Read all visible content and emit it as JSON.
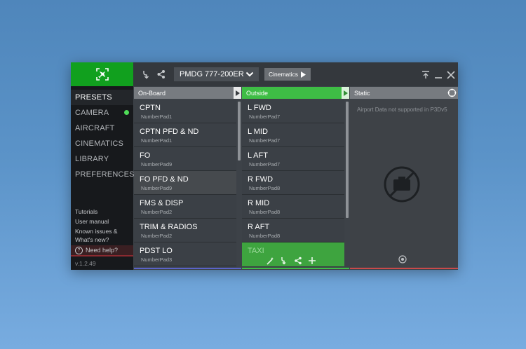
{
  "sidebar": {
    "items": [
      {
        "label": "PRESETS",
        "active": true
      },
      {
        "label": "CAMERA",
        "active": false,
        "status_dot": true
      },
      {
        "label": "AIRCRAFT",
        "active": false
      },
      {
        "label": "CINEMATICS",
        "active": false
      },
      {
        "label": "LIBRARY",
        "active": false
      },
      {
        "label": "PREFERENCES",
        "active": false
      }
    ],
    "links": {
      "tutorials": "Tutorials",
      "user_manual": "User manual",
      "known_issues": "Known issues &",
      "whats_new": "What's new?"
    },
    "help": "Need help?",
    "version": "v.1.2.49"
  },
  "toolbar": {
    "aircraft": "PMDG 777-200ER",
    "cinematics": "Cinematics"
  },
  "panels": {
    "onboard": {
      "title": "On-Board",
      "rows": [
        {
          "title": "CPTN",
          "key": "NumberPad1"
        },
        {
          "title": "CPTN PFD & ND",
          "key": "NumberPad1"
        },
        {
          "title": "FO",
          "key": "NumberPad9"
        },
        {
          "title": "FO PFD & ND",
          "key": "NumberPad9"
        },
        {
          "title": "FMS & DISP",
          "key": "NumberPad2"
        },
        {
          "title": "TRIM & RADIOS",
          "key": "NumberPad2"
        },
        {
          "title": "PDST LO",
          "key": "NumberPad3"
        }
      ]
    },
    "outside": {
      "title": "Outside",
      "rows": [
        {
          "title": "L FWD",
          "key": "NumberPad7"
        },
        {
          "title": "L MID",
          "key": "NumberPad7"
        },
        {
          "title": "L AFT",
          "key": "NumberPad7"
        },
        {
          "title": "R FWD",
          "key": "NumberPad8"
        },
        {
          "title": "R MID",
          "key": "NumberPad8"
        },
        {
          "title": "R AFT",
          "key": "NumberPad8"
        },
        {
          "title": "TAXI",
          "key": ""
        }
      ]
    },
    "static": {
      "title": "Static",
      "message": "Airport Data not supported in P3Dv5"
    }
  },
  "colors": {
    "accent_green": "#3ebd45",
    "onboard_line": "#5a63c8",
    "outside_line": "#3ebd45",
    "static_line": "#c84a4a"
  }
}
